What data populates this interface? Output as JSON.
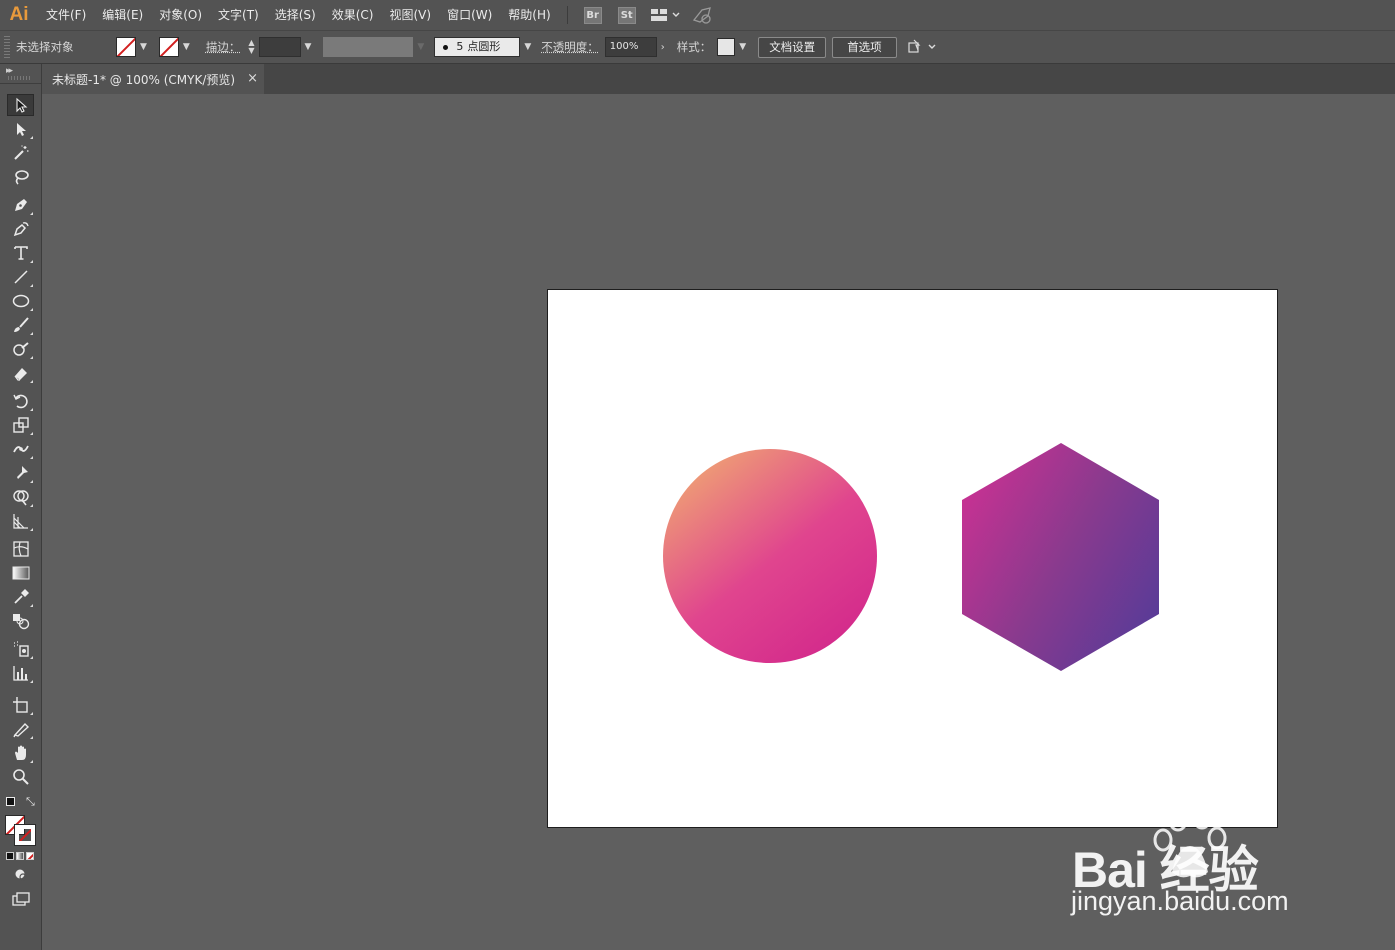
{
  "app": {
    "logo_text": "Ai"
  },
  "menu": {
    "items": [
      "文件(F)",
      "编辑(E)",
      "对象(O)",
      "文字(T)",
      "选择(S)",
      "效果(C)",
      "视图(V)",
      "窗口(W)",
      "帮助(H)"
    ],
    "bridge_label": "Br",
    "stock_label": "St"
  },
  "control_bar": {
    "selection_status": "未选择对象",
    "stroke_label": "描边：",
    "brush_size": "5",
    "brush_name": "点圆形",
    "opacity_label": "不透明度：",
    "opacity_value": "100%",
    "style_label": "样式：",
    "doc_setup_button": "文档设置",
    "preferences_button": "首选项"
  },
  "document": {
    "tab_title": "未标题-1* @ 100% (CMYK/预览)",
    "close_glyph": "×"
  },
  "artwork": {
    "circle_gradient": [
      "#efa174",
      "#e0458e",
      "#d42c8c"
    ],
    "hexagon_gradient": [
      "#c43292",
      "#8a3a8e",
      "#5b3b97"
    ]
  },
  "watermark": {
    "brand_text": "Bai  经验",
    "url": "jingyan.baidu.com"
  }
}
